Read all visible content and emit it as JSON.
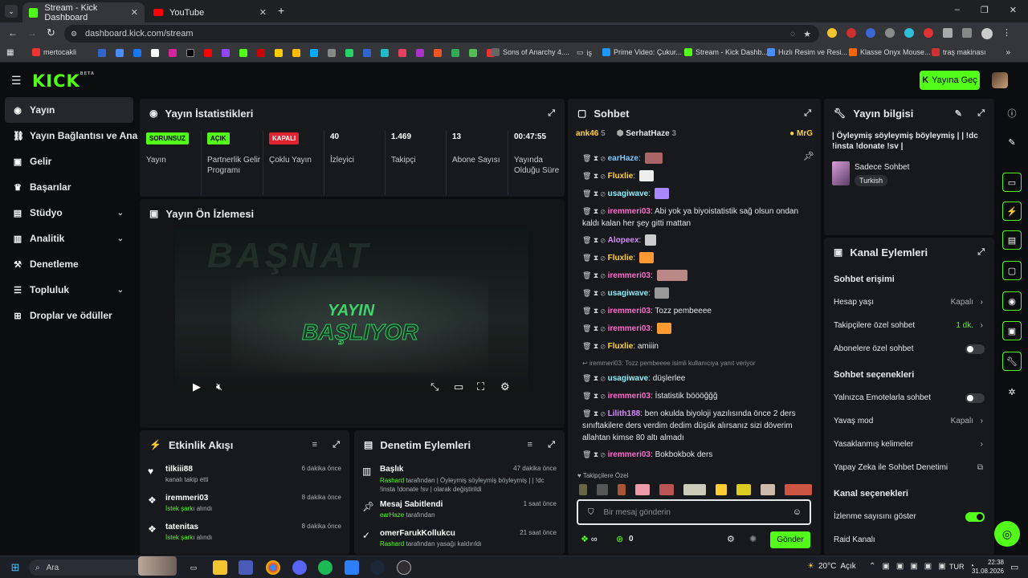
{
  "browser": {
    "tabs": [
      {
        "title": "Stream - Kick Dashboard",
        "active": true
      },
      {
        "title": "YouTube",
        "active": false
      }
    ],
    "url": "dashboard.kick.com/stream",
    "bookmarks": [
      "mertocakli",
      "Sons of Anarchy 4....",
      "iş",
      "Prime Video: Çukur...",
      "Stream - Kick Dashb...",
      "Hızlı Resim ve Resi...",
      "Klasse Onyx Mouse...",
      "traş makinası"
    ]
  },
  "header": {
    "logo": "KICK",
    "logo_tag": "BETA",
    "golive_label": "Yayına Geç"
  },
  "sidebar": {
    "items": [
      {
        "label": "Yayın",
        "icon": "broadcast-icon"
      },
      {
        "label": "Yayın Bağlantısı ve Anahtarı",
        "icon": "link-icon"
      },
      {
        "label": "Gelir",
        "icon": "wallet-icon"
      },
      {
        "label": "Başarılar",
        "icon": "trophy-icon"
      },
      {
        "label": "Stüdyo",
        "icon": "studio-icon"
      },
      {
        "label": "Analitik",
        "icon": "chart-icon"
      },
      {
        "label": "Denetleme",
        "icon": "hammer-icon"
      },
      {
        "label": "Topluluk",
        "icon": "community-icon"
      },
      {
        "label": "Droplar ve ödüller",
        "icon": "gift-icon"
      }
    ]
  },
  "stats": {
    "title": "Yayın İstatistikleri",
    "items": [
      {
        "badge": "SORUNSUZ",
        "badge_color": "#53fc18",
        "label": "Yayın"
      },
      {
        "badge": "AÇIK",
        "badge_color": "#53fc18",
        "label": "Partnerlik Gelir Programı"
      },
      {
        "badge": "KAPALI",
        "badge_color": "#e0232e",
        "label": "Çoklu Yayın"
      },
      {
        "value": "40",
        "label": "İzleyici"
      },
      {
        "value": "1.469",
        "label": "Takipçi"
      },
      {
        "value": "13",
        "label": "Abone Sayısı"
      },
      {
        "value": "00:47:55",
        "label": "Yayında Olduğu Süre"
      }
    ]
  },
  "preview": {
    "title": "Yayın Ön İzlemesi",
    "overlay_line1": "YAYIN",
    "overlay_line2": "BAŞLIYOR"
  },
  "activity": {
    "title": "Etkinlik Akışı",
    "items": [
      {
        "name": "tilkiii88",
        "detail": "kanalı takip etti",
        "time": "6 dakika önce"
      },
      {
        "name": "iremmeri03",
        "highlight": "İstek şarkı",
        "detail": "alındı",
        "time": "8 dakika önce"
      },
      {
        "name": "tatenitas",
        "highlight": "İstek şarkı",
        "detail": "alındı",
        "time": "8 dakika önce"
      }
    ]
  },
  "moderation": {
    "title": "Denetim Eylemleri",
    "items": [
      {
        "name": "Başlık",
        "actor": "Rashard",
        "detail": "tarafından | Öyleymiş söyleymiş böyleymiş | | !dc !insta !donate !sv | olarak değiştirildi",
        "time": "47 dakika önce"
      },
      {
        "name": "Mesaj Sabitlendi",
        "actor": "earHaze",
        "detail": "tarafından",
        "time": "1 saat önce"
      },
      {
        "name": "omerFarukKollukcu",
        "actor": "Rashard",
        "detail": "tarafından yasağı kaldırıldı",
        "time": "21 saat önce"
      }
    ]
  },
  "chat": {
    "title": "Sohbet",
    "top_users": [
      {
        "name": "ank46",
        "count": "5"
      },
      {
        "name": "SerhatHaze",
        "count": "3"
      },
      {
        "name": "MrG",
        "count": ""
      }
    ],
    "messages": [
      {
        "user": "earHaze",
        "color": "#7ec8ff",
        "text": ""
      },
      {
        "user": "Fluxlie",
        "color": "#ffd23f",
        "text": ""
      },
      {
        "user": "usagiwave",
        "color": "#8cf0ff",
        "text": ""
      },
      {
        "user": "iremmeri03",
        "color": "#ff6bd0",
        "text": "Abi yok ya biyoistatistik sağ olsun ondan kaldı kalan her şey gitti mattan"
      },
      {
        "user": "Alopeex",
        "color": "#d78cff",
        "text": ""
      },
      {
        "user": "Fluxlie",
        "color": "#ffd23f",
        "text": ""
      },
      {
        "user": "iremmeri03",
        "color": "#ff6bd0",
        "text": ""
      },
      {
        "user": "usagiwave",
        "color": "#8cf0ff",
        "text": ""
      },
      {
        "user": "iremmeri03",
        "color": "#ff6bd0",
        "text": "Tozz pembeeee"
      },
      {
        "user": "iremmeri03",
        "color": "#ff6bd0",
        "text": ""
      },
      {
        "user": "Fluxlie",
        "color": "#ffd23f",
        "text": "amiiin"
      },
      {
        "reply": "iremmeri03: Tozz pembeeee isimli kullanıcıya yanıt veriyor"
      },
      {
        "user": "usagiwave",
        "color": "#8cf0ff",
        "text": "düşlerlee"
      },
      {
        "user": "iremmeri03",
        "color": "#ff6bd0",
        "text": "İstatistik böööğğğ"
      },
      {
        "user": "Lilith188",
        "color": "#d78cff",
        "text": "ben okulda biyoloji yazılısında önce 2 ders sınıftakilere ders verdim dedim düşük alırsanız sizi döverim allahtan kimse 80 altı almadı"
      },
      {
        "user": "iremmeri03",
        "color": "#ff6bd0",
        "text": "Bokbokbok ders"
      }
    ],
    "followers_only_label": "Takipçilere Özel",
    "input_placeholder": "Bir mesaj gönderin",
    "footer_count": "0",
    "send_label": "Gönder"
  },
  "stream_info": {
    "title": "Yayın bilgisi",
    "stream_title": "| Öyleymiş söyleymiş böyleymiş | | !dc !insta !donate !sv |",
    "category": "Sadece Sohbet",
    "tag": "Turkish"
  },
  "channel_actions": {
    "title": "Kanal Eylemleri",
    "sections": [
      {
        "heading": "Sohbet erişimi",
        "rows": [
          {
            "label": "Hesap yaşı",
            "value": "Kapalı",
            "type": "arrow"
          },
          {
            "label": "Takipçilere özel sohbet",
            "value": "1 dk.",
            "type": "arrow",
            "value_color": "#53fc18"
          },
          {
            "label": "Abonelere özel sohbet",
            "type": "toggle",
            "on": false
          }
        ]
      },
      {
        "heading": "Sohbet seçenekleri",
        "rows": [
          {
            "label": "Yalnızca Emotelarla sohbet",
            "type": "toggle",
            "on": false
          },
          {
            "label": "Yavaş mod",
            "value": "Kapalı",
            "type": "arrow"
          },
          {
            "label": "Yasaklanmış kelimeler",
            "type": "arrow"
          },
          {
            "label": "Yapay Zeka ile Sohbet Denetimi",
            "type": "external"
          }
        ]
      },
      {
        "heading": "Kanal seçenekleri",
        "rows": [
          {
            "label": "İzlenme sayısını göster",
            "type": "toggle",
            "on": true
          },
          {
            "label": "Raid Kanalı",
            "type": "none"
          }
        ]
      }
    ]
  },
  "taskbar": {
    "search_label": "Ara",
    "weather": "20°C",
    "weather_desc": "Açık",
    "lang": "TUR",
    "time": "22:38",
    "date": "31.08.2026"
  },
  "colors": {
    "accent": "#53fc18",
    "panel": "#18191c",
    "background": "#0b0d0e",
    "danger": "#e0232e"
  }
}
